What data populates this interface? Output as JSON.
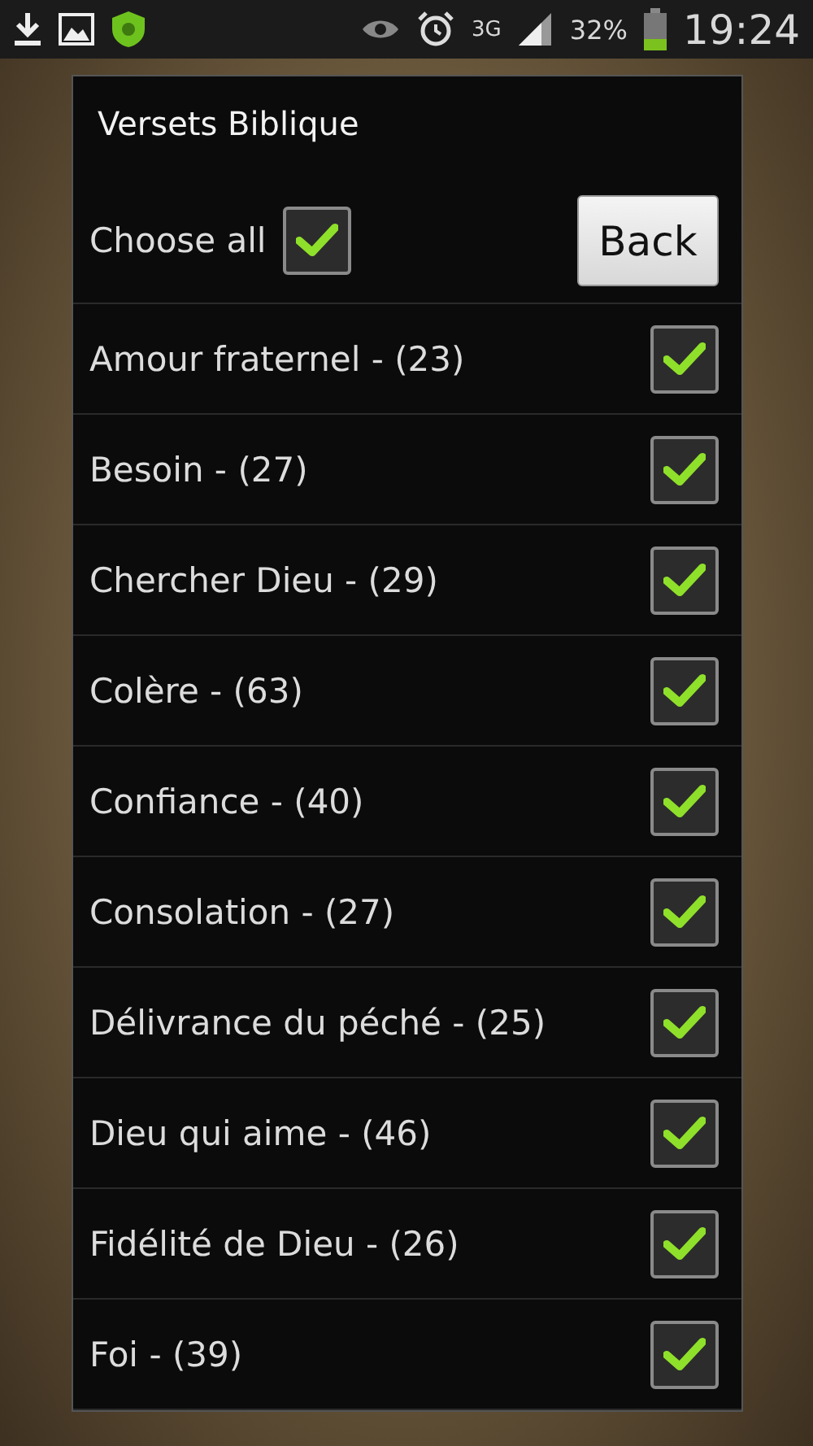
{
  "status_bar": {
    "network": "3G",
    "battery": "32%",
    "time": "19:24"
  },
  "dialog": {
    "title": "Versets Biblique",
    "choose_all": {
      "label": "Choose all",
      "checked": true
    },
    "back_button": "Back",
    "items": [
      {
        "label": "Amour fraternel - (23)",
        "checked": true
      },
      {
        "label": "Besoin - (27)",
        "checked": true
      },
      {
        "label": "Chercher Dieu - (29)",
        "checked": true
      },
      {
        "label": "Colère - (63)",
        "checked": true
      },
      {
        "label": "Confiance - (40)",
        "checked": true
      },
      {
        "label": "Consolation - (27)",
        "checked": true
      },
      {
        "label": "Délivrance du péché - (25)",
        "checked": true
      },
      {
        "label": "Dieu qui aime - (46)",
        "checked": true
      },
      {
        "label": "Fidélité de Dieu - (26)",
        "checked": true
      },
      {
        "label": "Foi - (39)",
        "checked": true
      }
    ]
  }
}
